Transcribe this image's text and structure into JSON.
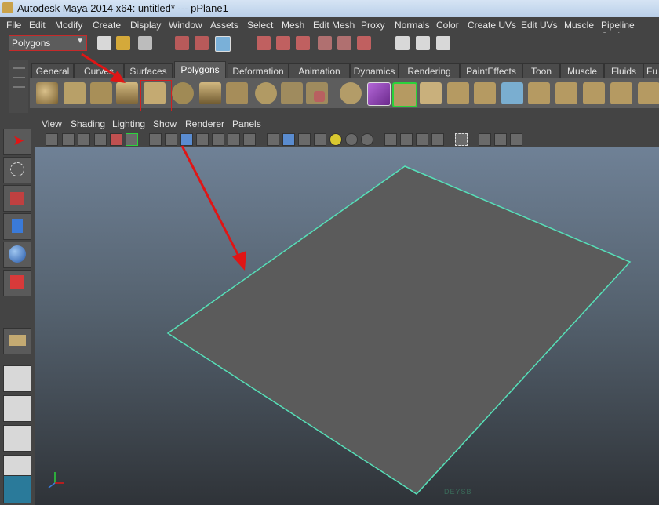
{
  "window": {
    "title": "Autodesk Maya 2014 x64: untitled*   ---   pPlane1"
  },
  "menu": [
    "File",
    "Edit",
    "Modify",
    "Create",
    "Display",
    "Window",
    "Assets",
    "Select",
    "Mesh",
    "Edit Mesh",
    "Proxy",
    "Normals",
    "Color",
    "Create UVs",
    "Edit UVs",
    "Muscle",
    "Pipeline Cache"
  ],
  "status_line": {
    "mode": "Polygons"
  },
  "shelf": {
    "tabs": [
      "General",
      "Curves",
      "Surfaces",
      "Polygons",
      "Deformation",
      "Animation",
      "Dynamics",
      "Rendering",
      "PaintEffects",
      "Toon",
      "Muscle",
      "Fluids",
      "Fu"
    ],
    "active_tab": "Polygons",
    "icons": [
      "poly-sphere-icon",
      "poly-cube-icon",
      "poly-cylinder-icon",
      "poly-cone-icon",
      "poly-plane-icon",
      "poly-torus-icon",
      "poly-pyramid-icon",
      "poly-pipe-icon",
      "poly-disc-icon",
      "poly-combine-icon",
      "poly-separate-icon",
      "poly-smooth-icon",
      "poly-reduce-icon",
      "poly-cube-purple-icon",
      "poly-extrude-icon",
      "poly-bridge-icon",
      "poly-append-icon",
      "poly-split-icon",
      "poly-bevel-icon",
      "poly-insert-loop-icon",
      "poly-merge-icon",
      "poly-fill-hole-icon",
      "poly-triangulate-icon",
      "poly-quadrangulate-icon",
      "poly-wedge-icon",
      "poly-duplicate-icon"
    ]
  },
  "panel": {
    "menus": [
      "View",
      "Shading",
      "Lighting",
      "Show",
      "Renderer",
      "Panels"
    ]
  },
  "viewport": {
    "object": "pPlane1",
    "wireframe_color": "#56e0b8",
    "plane_color": "#5b5b5b",
    "watermark": "DEYSB"
  },
  "colors": {
    "accent_red": "#e01515",
    "selection_green": "#2bd33b"
  }
}
